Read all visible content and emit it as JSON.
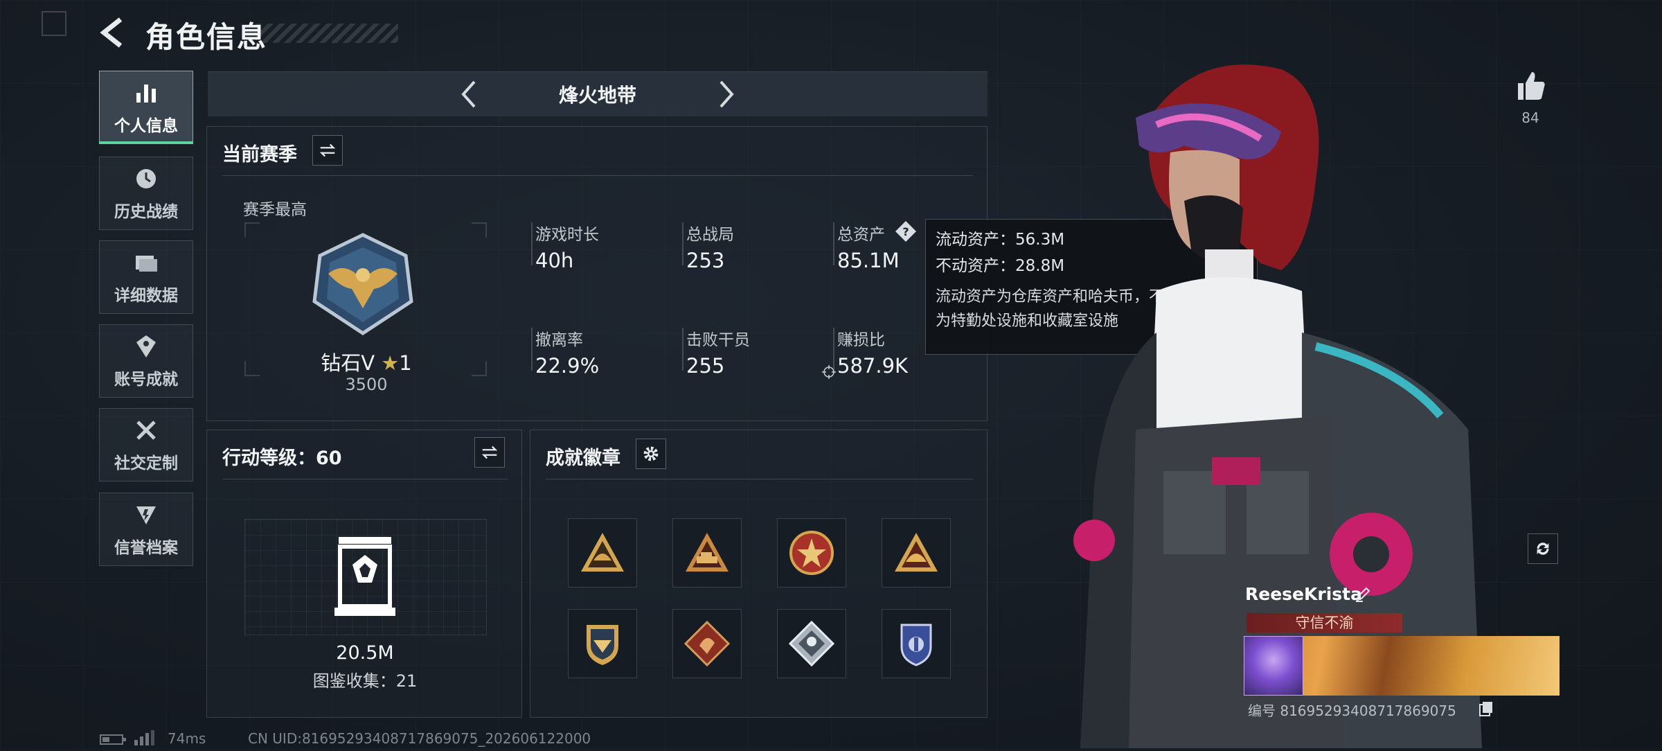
{
  "header": {
    "title": "角色信息"
  },
  "sidebar": {
    "items": [
      {
        "label": "个人信息",
        "active": true
      },
      {
        "label": "历史战绩"
      },
      {
        "label": "详细数据"
      },
      {
        "label": "账号成就"
      },
      {
        "label": "社交定制"
      },
      {
        "label": "信誉档案"
      }
    ]
  },
  "mode": {
    "title": "烽火地带"
  },
  "season": {
    "title": "当前赛季",
    "best_label": "赛季最高",
    "rank_name": "钻石V",
    "rank_stars": "1",
    "rank_score": "3500",
    "stats": [
      {
        "label": "游戏时长",
        "value": "40h"
      },
      {
        "label": "总战局",
        "value": "253"
      },
      {
        "label": "总资产",
        "value": "85.1M"
      },
      {
        "label": "撤离率",
        "value": "22.9%"
      },
      {
        "label": "击败干员",
        "value": "255"
      },
      {
        "label": "赚损比",
        "value": "587.9K"
      }
    ]
  },
  "tooltip": {
    "liquid": "流动资产：56.3M",
    "fixed": "不动资产：28.8M",
    "note_line1": "流动资产为仓库资产和哈夫币，不动资产",
    "note_line2": "为特勤处设施和收藏室设施"
  },
  "level": {
    "title": "行动等级：60",
    "value": "20.5M",
    "collection": "图鉴收集：21"
  },
  "badges": {
    "title": "成就徽章",
    "items": [
      "triangle-helmet",
      "triangle-tank",
      "round-star",
      "triangle-hardhat",
      "shield-gold",
      "diamond-dragon",
      "diamond-silver",
      "shield-blue"
    ]
  },
  "profile": {
    "likes": "84",
    "name": "ReeseKrista",
    "honor": "守信不渝",
    "id_text": "编号 8169529340871786907​5"
  },
  "footer": {
    "ping": "74ms",
    "uid": "CN UID:81695293408717869075_202606122000"
  },
  "colors": {
    "accent_green": "#5ed39b",
    "honor_red": "#8f2b2b",
    "gold": "#d4a650"
  }
}
